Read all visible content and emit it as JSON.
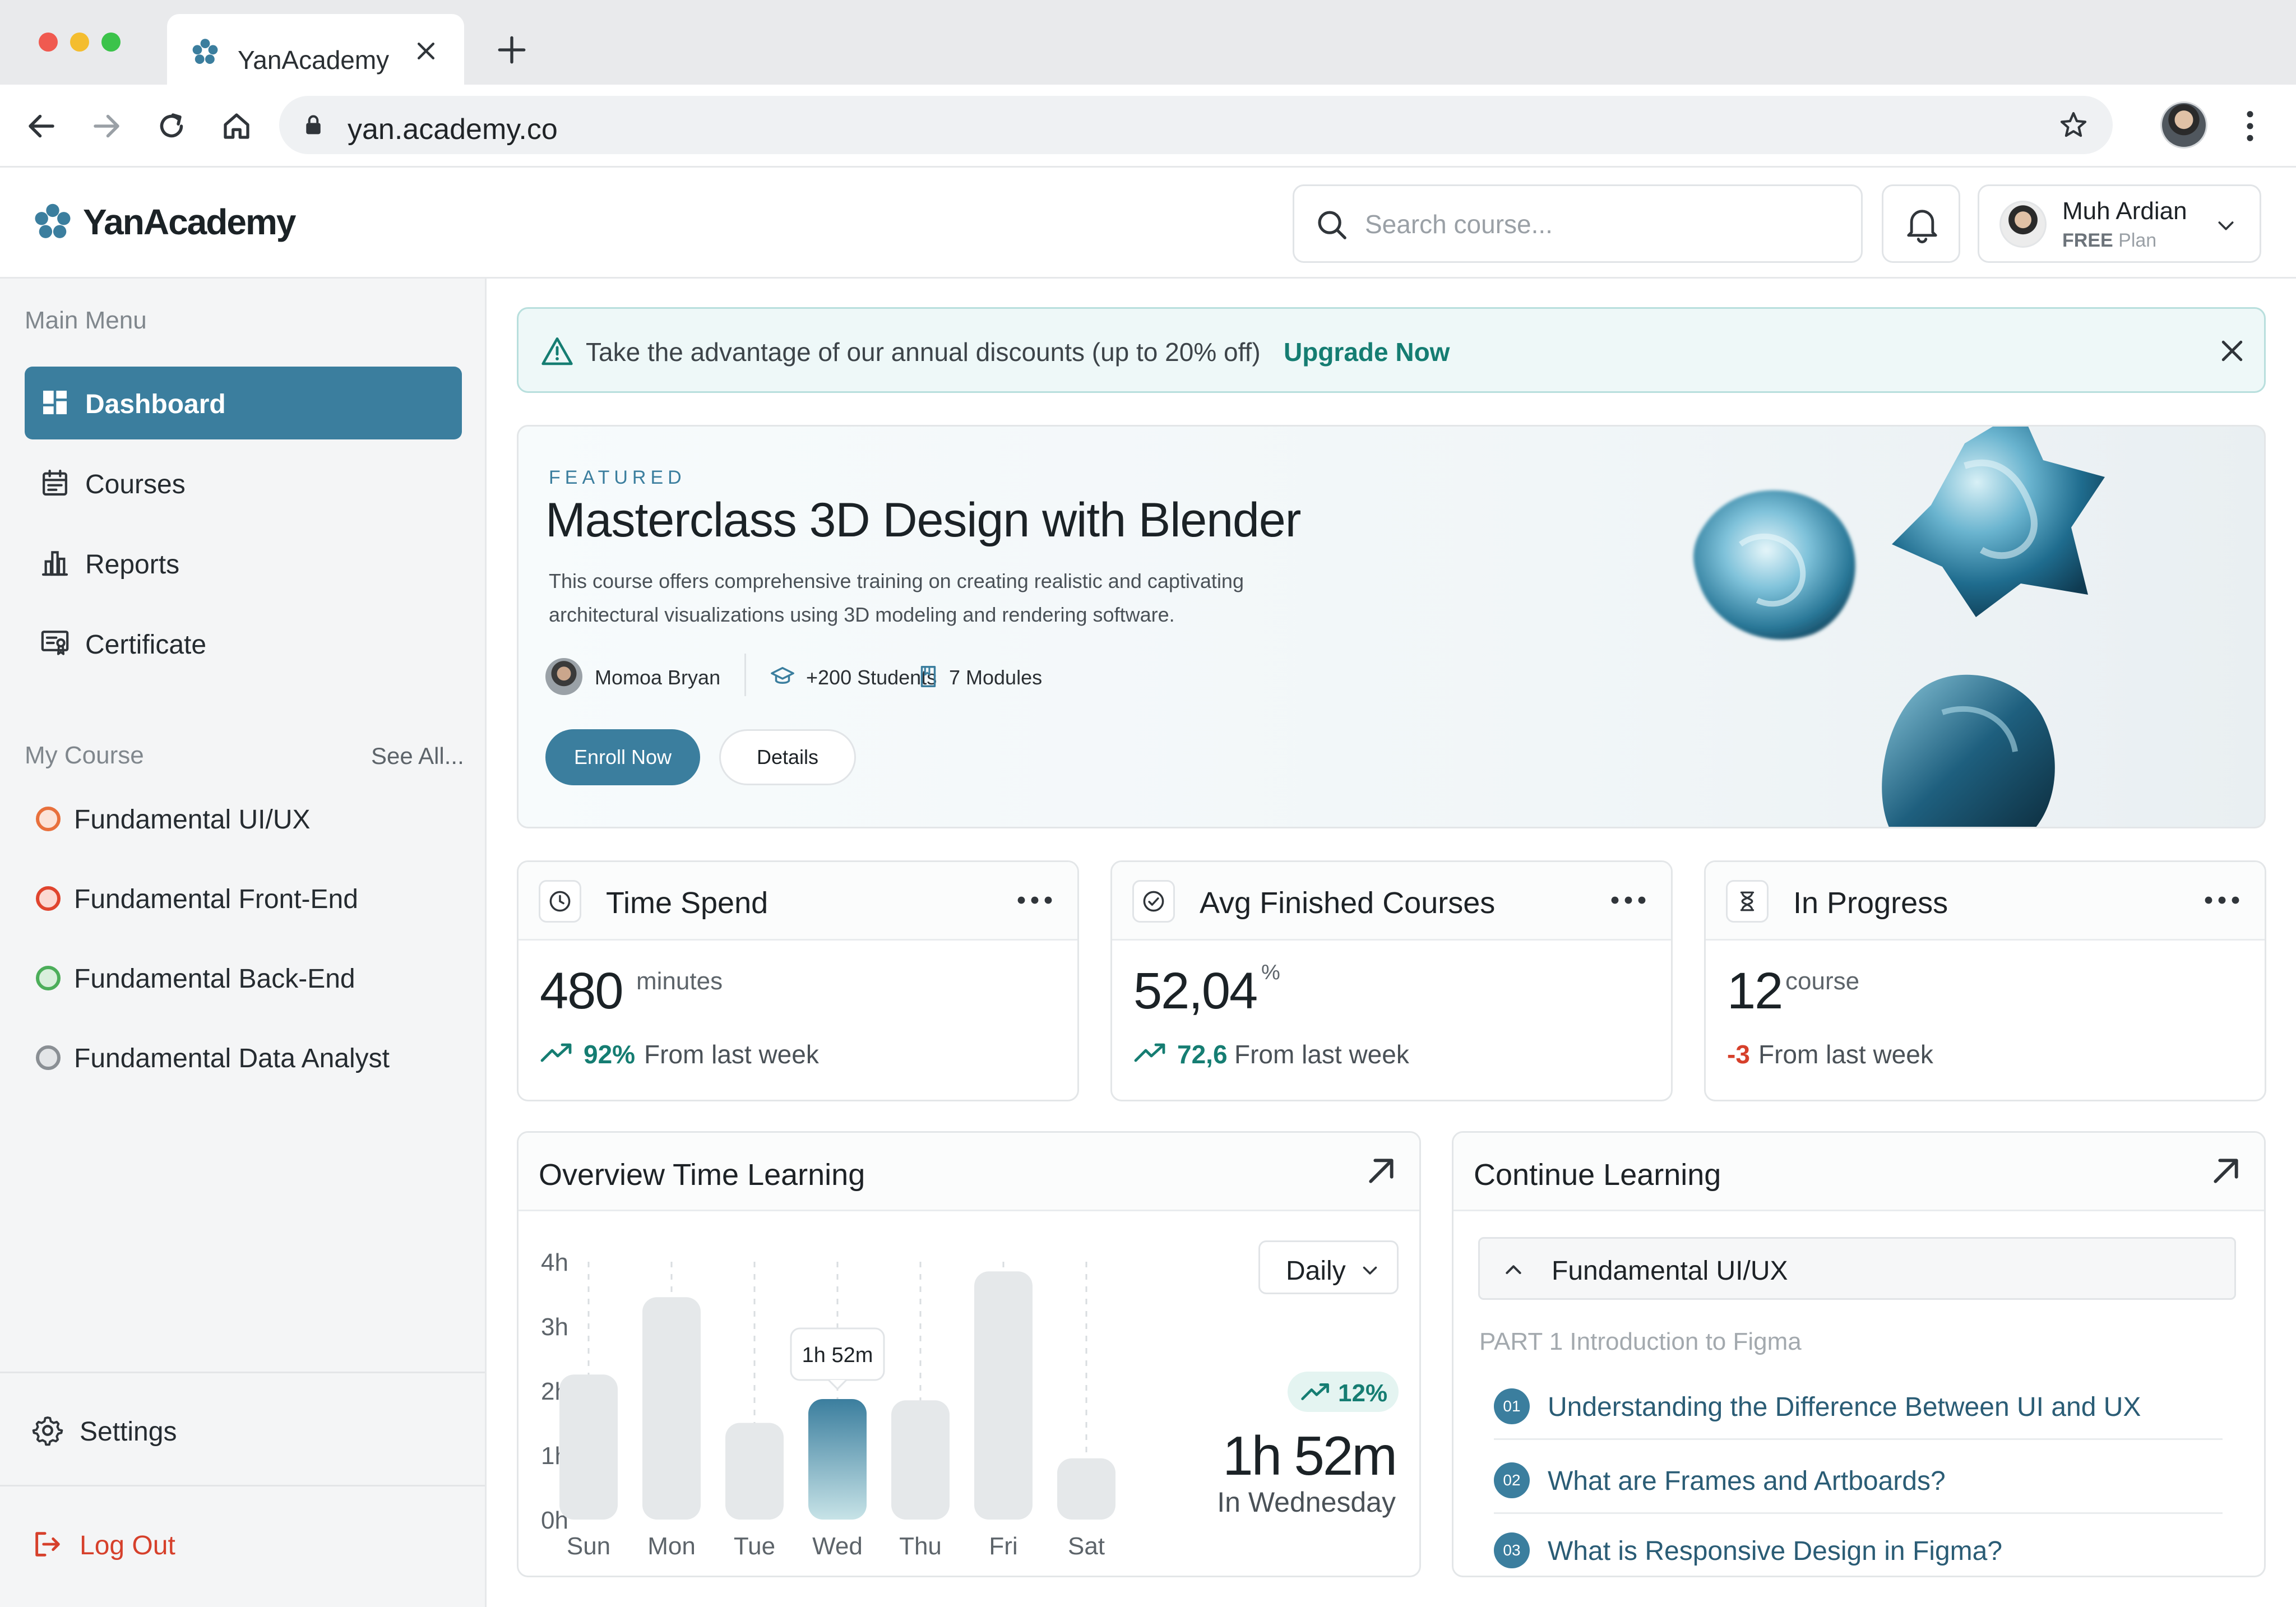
{
  "browser": {
    "tab_title": "YanAcademy",
    "url": "yan.academy.co"
  },
  "header": {
    "logo_text": "YanAcademy",
    "search_placeholder": "Search course...",
    "user_name": "Muh Ardian",
    "user_plan_tier": "FREE",
    "user_plan_suffix": "Plan"
  },
  "sidebar": {
    "main_menu_heading": "Main Menu",
    "items": [
      {
        "label": "Dashboard",
        "icon": "dashboard-icon",
        "active": true
      },
      {
        "label": "Courses",
        "icon": "calendar-icon",
        "active": false
      },
      {
        "label": "Reports",
        "icon": "bar-chart-icon",
        "active": false
      },
      {
        "label": "Certificate",
        "icon": "certificate-icon",
        "active": false
      }
    ],
    "my_course_heading": "My Course",
    "see_all": "See All...",
    "courses": [
      {
        "label": "Fundamental UI/UX",
        "color": "#e8703c"
      },
      {
        "label": "Fundamental Front-End",
        "color": "#e0442e"
      },
      {
        "label": "Fundamental Back-End",
        "color": "#4cae5a"
      },
      {
        "label": "Fundamental Data Analyst",
        "color": "#8a8f94"
      }
    ],
    "settings": "Settings",
    "logout": "Log Out"
  },
  "banner": {
    "text": "Take the advantage of our annual discounts (up to 20% off)",
    "link": "Upgrade Now"
  },
  "featured": {
    "label": "FEATURED",
    "title": "Masterclass 3D Design with Blender",
    "description": "This course offers comprehensive training on creating realistic and captivating architectural visualizations using 3D modeling and rendering software.",
    "instructor": "Momoa Bryan",
    "students": "+200 Students",
    "modules": "7 Modules",
    "enroll_label": "Enroll Now",
    "details_label": "Details"
  },
  "stats": [
    {
      "title": "Time Spend",
      "icon": "clock-icon",
      "value": "480",
      "unit": "minutes",
      "trend_value": "92%",
      "trend_text": "From last week",
      "trend_color": "#157d72",
      "trend_up": true
    },
    {
      "title": "Avg Finished Courses",
      "icon": "check-circle-icon",
      "value": "52,04",
      "unit": "%",
      "trend_value": "72,6",
      "trend_text": "From last week",
      "trend_color": "#157d72",
      "trend_up": true
    },
    {
      "title": "In Progress",
      "icon": "hourglass-icon",
      "value": "12",
      "unit": "course",
      "trend_value": "-3",
      "trend_text": "From last week",
      "trend_color": "#d6402b",
      "trend_up": false
    }
  ],
  "overview": {
    "title": "Overview Time Learning",
    "period": "Daily",
    "trend": "12%",
    "highlight_time": "1h 52m",
    "highlight_day": "In Wednesday"
  },
  "chart_data": {
    "type": "bar",
    "categories": [
      "Sun",
      "Mon",
      "Tue",
      "Wed",
      "Thu",
      "Fri",
      "Sat"
    ],
    "values": [
      2.25,
      3.45,
      1.5,
      1.87,
      1.85,
      3.85,
      0.95
    ],
    "unit": "hours",
    "y_ticks": [
      "0h",
      "1h",
      "2h",
      "3h",
      "4h"
    ],
    "ylim": [
      0,
      4
    ],
    "highlight_index": 3,
    "tooltip": "1h 52m",
    "colors": {
      "bar": "#e5e8ea",
      "highlight_top": "#3b7e9e",
      "highlight_bottom": "#c7e3e7"
    }
  },
  "continue": {
    "title": "Continue Learning",
    "course": "Fundamental UI/UX",
    "part": "PART 1  Introduction to Figma",
    "lessons": [
      {
        "num": "01",
        "title": "Understanding the Difference Between UI and UX"
      },
      {
        "num": "02",
        "title": "What are Frames and Artboards?"
      },
      {
        "num": "03",
        "title": "What is Responsive Design in Figma?"
      }
    ]
  },
  "colors": {
    "accent": "#3b7e9e",
    "success": "#157d72",
    "danger": "#d6402b"
  }
}
